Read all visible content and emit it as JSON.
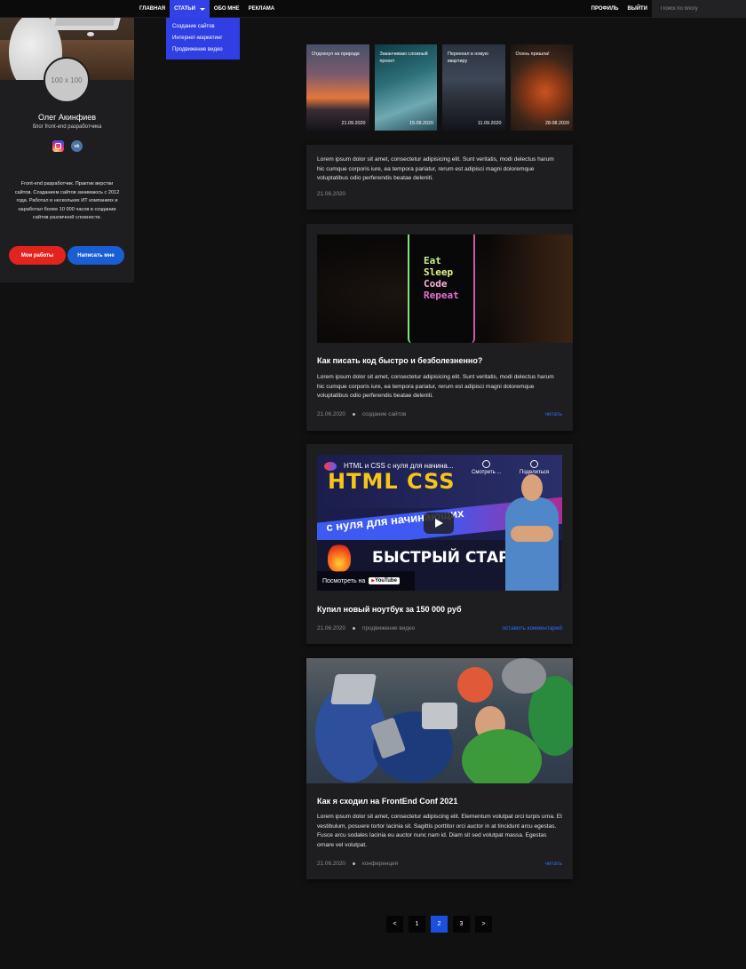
{
  "nav": {
    "items": [
      {
        "label": "ГЛАВНАЯ"
      },
      {
        "label": "СТАТЬИ"
      },
      {
        "label": "ОБО МНЕ"
      },
      {
        "label": "РЕКЛАМА"
      }
    ],
    "profile": "ПРОФИЛЬ",
    "logout": "ВЫЙТИ",
    "search_placeholder": "Поиск по блогу",
    "dropdown": [
      {
        "label": "Создание сайтов"
      },
      {
        "label": "Интернет-маркетинг"
      },
      {
        "label": "Продвижение видео"
      }
    ]
  },
  "sidebar": {
    "avatar_text": "100 x 100",
    "name": "Олег Акинфиев",
    "subtitle": "блог front-end разработчика",
    "social_icons": [
      "instagram-icon",
      "vk-icon"
    ],
    "bio": "Front-end разработчик. Практик верстки сайтов. Созданием сайтов занимаюсь с 2012 года. Работал в нескольких ИТ компаниях и наработал более 10 000 часов в создании сайтов различной сложности.",
    "btn_works": "Мои работы",
    "btn_write": "Написать мне"
  },
  "featured": [
    {
      "title": "Отдохнул на природе",
      "date": "21.09.2020"
    },
    {
      "title": "Заканчиваю сложный проект",
      "date": "15.09.2020"
    },
    {
      "title": "Переехал в новую квартиру",
      "date": "11.09.2020"
    },
    {
      "title": "Осень пришла!",
      "date": "28.08.2020"
    }
  ],
  "posts": [
    {
      "text": "Lorem ipsum dolor sit amet, consectetur adipisicing elit. Sunt veritatis, modi delectus harum hic cumque corporis iure, ea tempora pariatur, rerum est adipisci magni doloremque voluptatibus odio perferendis beatae deleniti.",
      "date": "21.06.2020"
    },
    {
      "title": "Как писать код быстро и безболезненно?",
      "text": "Lorem ipsum dolor sit amet, consectetur adipisicing elit. Sunt veritatis, modi delectus harum hic cumque corporis iure, ea tempora pariatur, rerum est adipisci magni doloremque voluptatibus odio perferendis beatae deleniti.",
      "date": "21.06.2020",
      "category": "создание сайтов",
      "link": "читать",
      "image_words": [
        "Eat",
        "Sleep",
        "Code",
        "Repeat"
      ]
    },
    {
      "title": "Купил новый ноутбук за 150 000 руб",
      "date": "21.06.2020",
      "category": "продвижение видео",
      "link": "оставить комментарий",
      "video": {
        "title": "HTML и CSS с нуля для начина...",
        "watch_later": "Смотреть ...",
        "share": "Поделиться",
        "headline": "HTML CSS",
        "subline": "с нуля для начинающих",
        "bottom": "БЫСТРЫЙ СТАРТ",
        "watch_on": "Посмотреть на",
        "platform": "YouTube"
      }
    },
    {
      "title": "Как я сходил на FrontEnd Conf 2021",
      "text": "Lorem ipsum dolor sit amet, consectetur adipiscing elit. Elementum volutpat orci turpis urna. Et vestibulum, posuere tortor lacinia sit. Sagittis porttitor orci auctor in at tincidunt arcu egestas. Fusce arcu sodales lacinia eu auctor nunc nam id. Diam sit sed volutpat massa. Egestas ornare vel volutpat.",
      "date": "21.06.2020",
      "category": "конференция",
      "link": "читать"
    }
  ],
  "pagination": {
    "prev": "<",
    "pages": [
      "1",
      "2",
      "3"
    ],
    "current": "2",
    "next": ">"
  }
}
